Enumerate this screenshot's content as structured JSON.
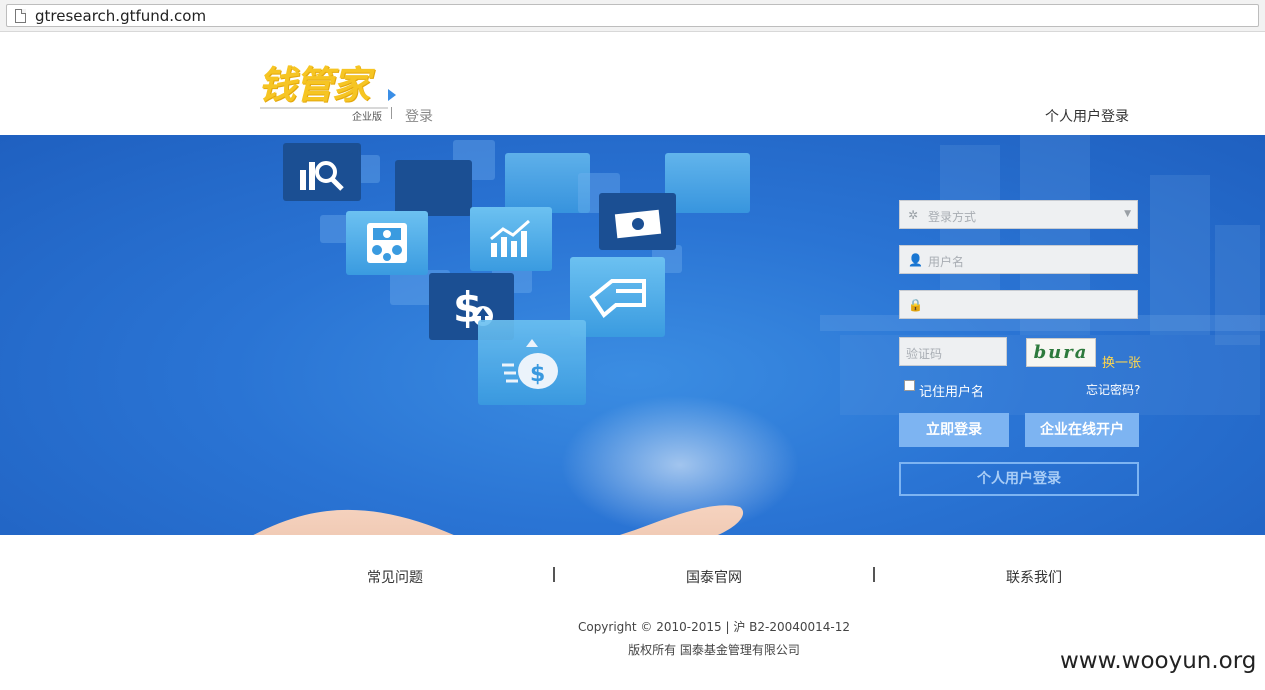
{
  "browser": {
    "url": "gtresearch.gtfund.com"
  },
  "header": {
    "logo_text": "钱管家",
    "edition": "企业版",
    "login_label": "登录",
    "personal_login_link": "个人用户登录"
  },
  "login_form": {
    "login_method_placeholder": "登录方式",
    "username_placeholder": "用户名",
    "password_placeholder": "",
    "captcha_placeholder": "验证码",
    "captcha_image_text": "bura",
    "refresh_captcha": "换一张",
    "remember_label": "记住用户名",
    "forgot_label": "忘记密码?",
    "login_button": "立即登录",
    "open_account_button": "企业在线开户",
    "personal_login_button": "个人用户登录"
  },
  "footer": {
    "links": [
      "常见问题",
      "国泰官网",
      "联系我们"
    ],
    "separator": "|",
    "copyright": "Copyright © 2010-2015 | 沪 B2-20040014-12",
    "owner": "版权所有 国泰基金管理有限公司"
  },
  "watermark": "www.wooyun.org",
  "colors": {
    "banner_blue": "#2a74d4",
    "button_blue": "#7db4f2",
    "logo_yellow": "#f6c523",
    "refresh_yellow": "#ffd74d"
  }
}
